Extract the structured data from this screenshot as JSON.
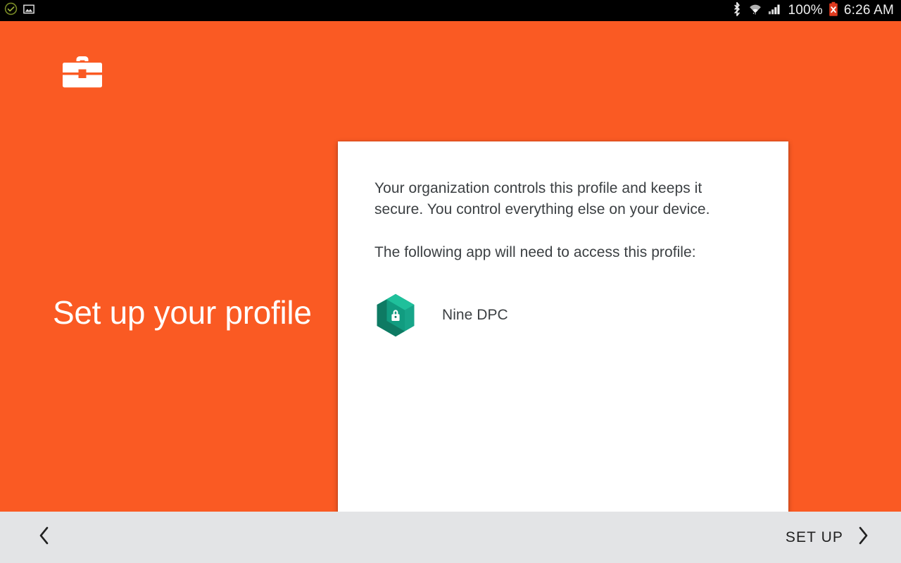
{
  "statusbar": {
    "left_icons": [
      {
        "name": "check-circle-icon",
        "label": "check-circle"
      },
      {
        "name": "image-icon",
        "label": "image"
      }
    ],
    "right_icons": [
      {
        "name": "bluetooth-icon",
        "label": "bluetooth"
      },
      {
        "name": "wifi-icon",
        "label": "wifi"
      },
      {
        "name": "cellular-signal-icon",
        "label": "cellular-signal"
      }
    ],
    "battery_percent": "100%",
    "battery_icon": "battery-error-icon",
    "time": "6:26 AM"
  },
  "theme": {
    "accent_orange": "#FA5A23",
    "card_background": "#FFFFFF",
    "bottom_bar": "#E3E4E6",
    "app_icon_teal": "#17A589",
    "app_icon_teal_dark": "#0E7A63",
    "text_primary": "#3C4043",
    "status_bar": "#000000"
  },
  "hero": {
    "logo_icon": "briefcase-icon",
    "headline": "Set up your profile"
  },
  "card": {
    "paragraph_1": "Your organization controls this profile and keeps it secure. You control everything else on your device.",
    "paragraph_2": "The following app will need to access this profile:",
    "app": {
      "icon": "hexagon-lock-icon",
      "name": "Nine DPC"
    }
  },
  "bottombar": {
    "back_icon": "chevron-left-icon",
    "setup_label": "SET UP",
    "next_icon": "chevron-right-icon"
  }
}
